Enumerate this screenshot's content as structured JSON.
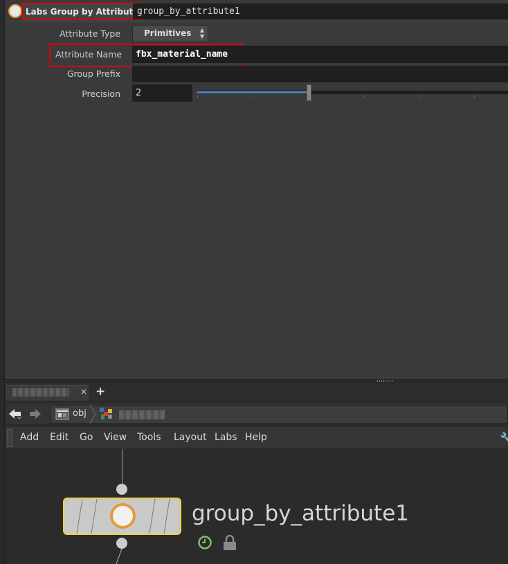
{
  "header": {
    "node_type": "Labs Group by Attribute",
    "node_name": "group_by_attribute1"
  },
  "params": {
    "attribute_type": {
      "label": "Attribute Type",
      "value": "Primitives"
    },
    "attribute_name": {
      "label": "Attribute Name",
      "value": "fbx_material_name"
    },
    "group_prefix": {
      "label": "Group Prefix",
      "value": ""
    },
    "precision": {
      "label": "Precision",
      "value": "2",
      "slider_fraction": 0.36
    }
  },
  "network": {
    "tab_add": "+",
    "tab_close": "×",
    "path": {
      "root": "obj"
    },
    "menu": [
      "Add",
      "Edit",
      "Go",
      "View",
      "Tools",
      "Layout",
      "Labs",
      "Help"
    ],
    "node": {
      "label": "group_by_attribute1"
    }
  },
  "icons": {
    "node_type": "node-type-icon",
    "back": "back-arrow-icon",
    "forward": "forward-arrow-icon",
    "obj": "obj-context-icon",
    "geo": "geo-node-icon",
    "wrench": "wrench-icon",
    "clock": "clock-icon",
    "lock": "lock-icon"
  },
  "colors": {
    "highlight": "#e00000",
    "node_selected_border": "#f0d23a",
    "node_accent": "#e39a3a",
    "slider_fill": "#4f88c6"
  }
}
